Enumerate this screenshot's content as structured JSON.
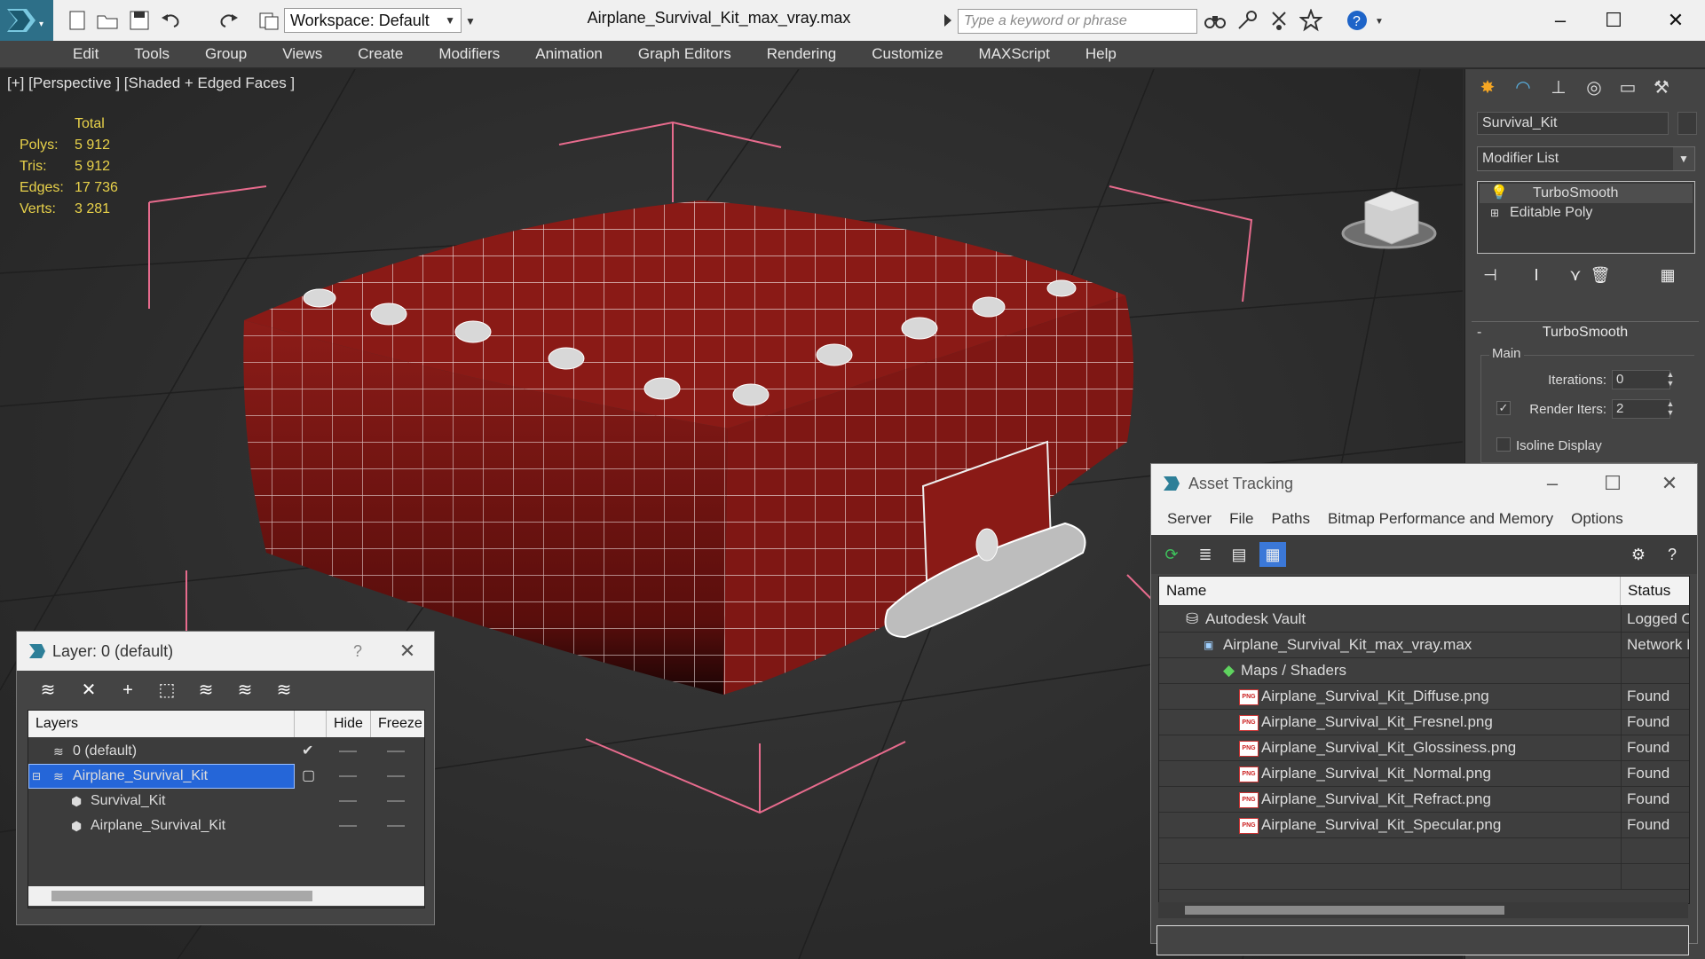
{
  "app": {
    "title": "Airplane_Survival_Kit_max_vray.max",
    "workspace": "Workspace: Default",
    "search_placeholder": "Type a keyword or phrase"
  },
  "menu": [
    "Edit",
    "Tools",
    "Group",
    "Views",
    "Create",
    "Modifiers",
    "Animation",
    "Graph Editors",
    "Rendering",
    "Customize",
    "MAXScript",
    "Help"
  ],
  "viewport": {
    "label": "[+] [Perspective ] [Shaded + Edged Faces ]",
    "stats": {
      "header": "Total",
      "polys_label": "Polys:",
      "polys": "5 912",
      "tris_label": "Tris:",
      "tris": "5 912",
      "edges_label": "Edges:",
      "edges": "17 736",
      "verts_label": "Verts:",
      "verts": "3 281"
    },
    "colors": {
      "mesh": "#8a1a16",
      "wire": "#ffffff",
      "bbox": "#e76b8d",
      "stats": "#e9d24a"
    }
  },
  "command_panel": {
    "object_name": "Survival_Kit",
    "modifier_list": "Modifier List",
    "stack": [
      "TurboSmooth",
      "Editable Poly"
    ],
    "rollout_title": "TurboSmooth",
    "group_main": "Main",
    "iterations_label": "Iterations:",
    "iterations": "0",
    "render_iters_label": "Render Iters:",
    "render_iters": "2",
    "isoline_label": "Isoline Display"
  },
  "layer_dialog": {
    "title": "Layer: 0 (default)",
    "help": "?",
    "columns": {
      "layers": "Layers",
      "hide": "Hide",
      "freeze": "Freeze"
    },
    "rows": [
      {
        "name": "0 (default)"
      },
      {
        "name": "Airplane_Survival_Kit"
      },
      {
        "name": "Survival_Kit"
      },
      {
        "name": "Airplane_Survival_Kit"
      }
    ]
  },
  "asset_tracking": {
    "title": "Asset Tracking",
    "menu": [
      "Server",
      "File",
      "Paths",
      "Bitmap Performance and Memory",
      "Options"
    ],
    "columns": {
      "name": "Name",
      "status": "Status"
    },
    "rows": [
      {
        "name": "Autodesk Vault",
        "status": "Logged Out"
      },
      {
        "name": "Airplane_Survival_Kit_max_vray.max",
        "status": "Network Path"
      },
      {
        "name": "Maps / Shaders",
        "status": ""
      },
      {
        "name": "Airplane_Survival_Kit_Diffuse.png",
        "status": "Found"
      },
      {
        "name": "Airplane_Survival_Kit_Fresnel.png",
        "status": "Found"
      },
      {
        "name": "Airplane_Survival_Kit_Glossiness.png",
        "status": "Found"
      },
      {
        "name": "Airplane_Survival_Kit_Normal.png",
        "status": "Found"
      },
      {
        "name": "Airplane_Survival_Kit_Refract.png",
        "status": "Found"
      },
      {
        "name": "Airplane_Survival_Kit_Specular.png",
        "status": "Found"
      }
    ],
    "png_badge": "PNG"
  }
}
